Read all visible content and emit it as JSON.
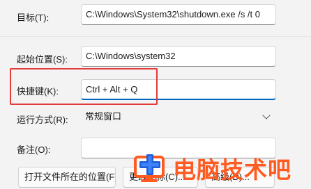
{
  "form": {
    "target_label": "目标(T):",
    "target_value": "C:\\Windows\\System32\\shutdown.exe /s /t 0",
    "start_label": "起始位置(S):",
    "start_value": "C:\\Windows\\system32",
    "hotkey_label": "快捷键(K):",
    "hotkey_value": "Ctrl + Alt + Q",
    "run_label": "运行方式(R):",
    "run_value": "常规窗口",
    "comment_label": "备注(O):",
    "comment_value": ""
  },
  "buttons": {
    "open_location": "打开文件所在的位置(F)",
    "change_icon": "更改图标(C)...",
    "advanced": "高级(D)..."
  },
  "watermark": {
    "text": "电脑技术吧",
    "color": "#ff5a1f",
    "icon": "computer-plus-logo"
  },
  "accent": "#0067c0",
  "highlight_color": "#e33a3a"
}
